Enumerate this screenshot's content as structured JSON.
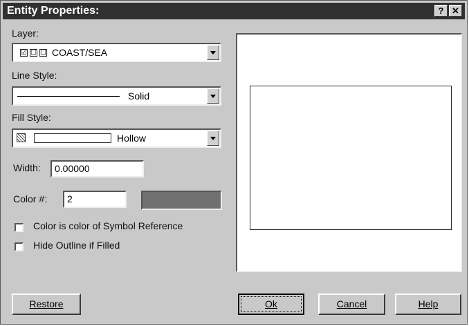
{
  "window": {
    "title": "Entity Properties:",
    "help_glyph": "?",
    "close_glyph": "✕"
  },
  "layer": {
    "label": "Layer:",
    "value": "COAST/SEA",
    "flags": [
      "☑",
      "☐",
      "☐"
    ]
  },
  "line_style": {
    "label": "Line Style:",
    "value": "Solid"
  },
  "fill_style": {
    "label": "Fill Style:",
    "value": "Hollow"
  },
  "width": {
    "label": "Width:",
    "value": "0.00000"
  },
  "color": {
    "label": "Color #:",
    "value": "2",
    "swatch_color": "#707070"
  },
  "options": {
    "symbol_ref": "Color is color of Symbol Reference",
    "hide_outline": "Hide Outline if Filled"
  },
  "buttons": {
    "restore": "Restore",
    "ok": "Ok",
    "cancel": "Cancel",
    "help": "Help"
  }
}
